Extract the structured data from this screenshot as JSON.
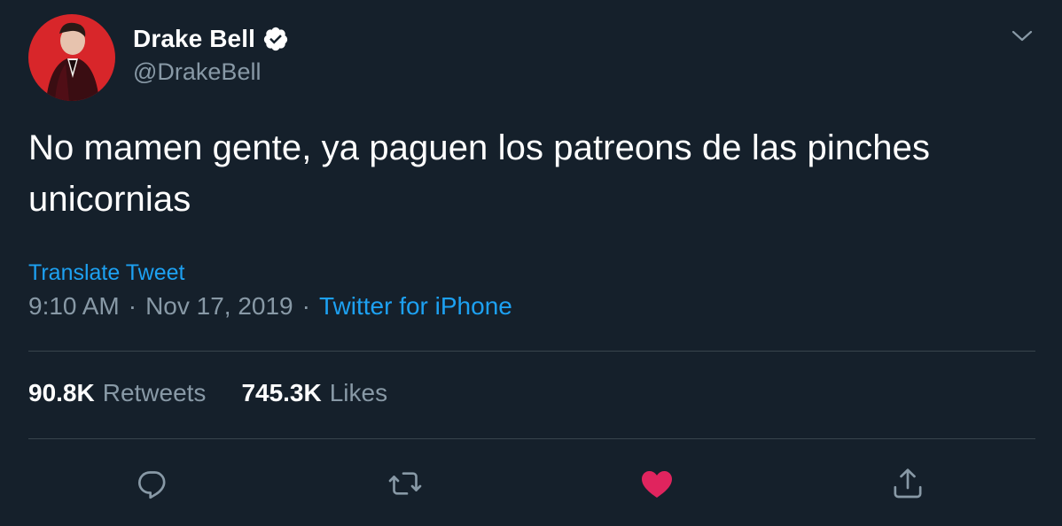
{
  "author": {
    "display_name": "Drake Bell",
    "handle": "@DrakeBell",
    "verified": true
  },
  "tweet": {
    "text": "No mamen gente, ya paguen los patreons de las pinches unicornias",
    "translate_label": "Translate Tweet",
    "time": "9:10 AM",
    "date": "Nov 17, 2019",
    "separator": "·",
    "source": "Twitter for iPhone"
  },
  "stats": {
    "retweets_count": "90.8K",
    "retweets_label": "Retweets",
    "likes_count": "745.3K",
    "likes_label": "Likes"
  },
  "actions": {
    "reply_icon": "reply-icon",
    "retweet_icon": "retweet-icon",
    "like_icon": "heart-icon",
    "share_icon": "share-icon",
    "liked": true
  },
  "colors": {
    "background": "#15202b",
    "primary_text": "#ffffff",
    "secondary_text": "#8899a6",
    "link": "#1da1f2",
    "divider": "#38444d",
    "like": "#e0245e",
    "avatar_background": "#d8262a"
  }
}
